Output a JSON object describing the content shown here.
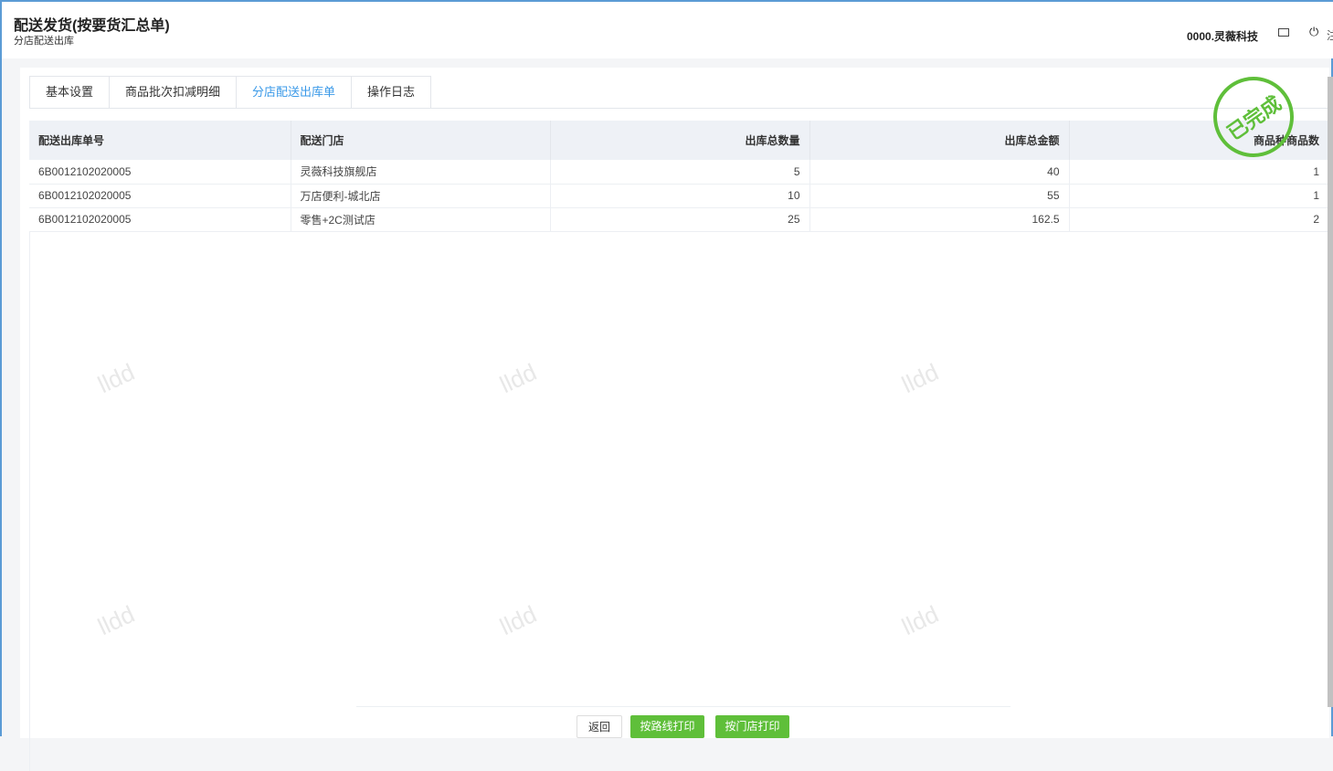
{
  "header": {
    "title": "配送发货(按要货汇总单)",
    "subtitle": "分店配送出库",
    "user": "0000.灵薇科技",
    "logout": "注",
    "icons": [
      "mail-icon",
      "power-icon"
    ]
  },
  "tabs": [
    {
      "label": "基本设置"
    },
    {
      "label": "商品批次扣减明细"
    },
    {
      "label": "分店配送出库单",
      "active": true
    },
    {
      "label": "操作日志"
    }
  ],
  "stamp": "已完成",
  "watermark": "lldd",
  "table": {
    "columns": [
      "配送出库单号",
      "配送门店",
      "出库总数量",
      "出库总金额",
      "商品种商品数"
    ],
    "rows": [
      [
        "6B0012102020005",
        "灵薇科技旗舰店",
        "5",
        "40",
        "1"
      ],
      [
        "6B0012102020005",
        "万店便利-城北店",
        "10",
        "55",
        "1"
      ],
      [
        "6B0012102020005",
        "零售+2C测试店",
        "25",
        "162.5",
        "2"
      ]
    ]
  },
  "footer": {
    "back": "返回",
    "print_route": "按路线打印",
    "print_store": "按门店打印"
  },
  "colors": {
    "accent": "#3a99e8",
    "green": "#5fbf3a"
  }
}
